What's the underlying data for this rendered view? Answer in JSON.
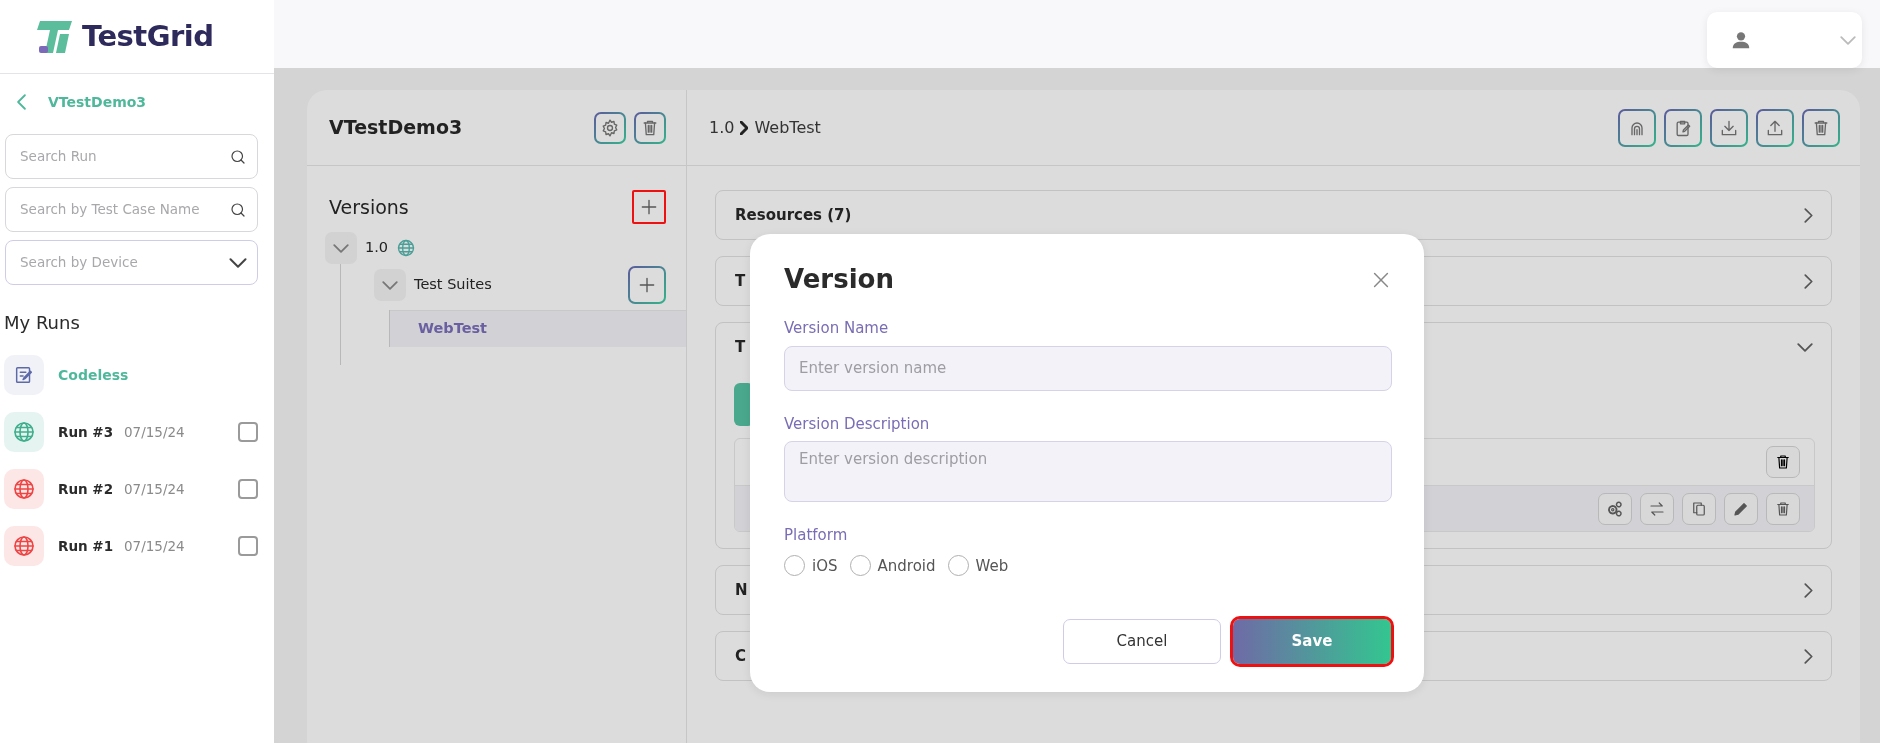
{
  "sidebar": {
    "logo": "TestGrid",
    "back_label": "VTestDemo3",
    "searches": [
      {
        "kind": "search",
        "placeholder": "Search Run"
      },
      {
        "kind": "search",
        "placeholder": "Search by Test Case Name"
      },
      {
        "kind": "select",
        "placeholder": "Search by Device"
      }
    ],
    "section_title": "My Runs",
    "items": [
      {
        "kind": "codeless",
        "label": "Codeless"
      },
      {
        "kind": "run",
        "label": "Run #3",
        "date": "07/15/24",
        "color": "#3fae8c",
        "checked": false
      },
      {
        "kind": "run",
        "label": "Run #2",
        "date": "07/15/24",
        "color": "#ee4444",
        "checked": false
      },
      {
        "kind": "run",
        "label": "Run #1",
        "date": "07/15/24",
        "color": "#ee4444",
        "checked": false
      }
    ]
  },
  "project": {
    "title": "VTestDemo3",
    "versions_title": "Versions",
    "add_highlighted": true,
    "tree": [
      {
        "label": "1.0",
        "expanded": true,
        "children": [
          {
            "label": "Test Suites",
            "expanded": true,
            "children": [
              {
                "label": "WebTest",
                "selected": true
              }
            ]
          }
        ]
      }
    ]
  },
  "breadcrumb": [
    "1.0",
    "WebTest"
  ],
  "sections": [
    {
      "title": "Resources (7)",
      "expanded": false
    },
    {
      "title": "T",
      "expanded": false
    },
    {
      "title": "T",
      "expanded": true
    },
    {
      "title": "N",
      "expanded": false
    },
    {
      "title": "C",
      "expanded": false
    }
  ],
  "modal": {
    "title": "Version",
    "fields": [
      {
        "kind": "input",
        "label": "Version Name",
        "placeholder": "Enter version name"
      },
      {
        "kind": "textarea",
        "label": "Version Description",
        "placeholder": "Enter version description"
      }
    ],
    "platform_label": "Platform",
    "platforms": [
      {
        "label": "iOS",
        "selected": false
      },
      {
        "label": "Android",
        "selected": false
      },
      {
        "label": "Web",
        "selected": false
      }
    ],
    "buttons": [
      {
        "kind": "secondary",
        "label": "Cancel",
        "highlighted": false
      },
      {
        "kind": "primary",
        "label": "Save",
        "highlighted": true
      }
    ]
  }
}
